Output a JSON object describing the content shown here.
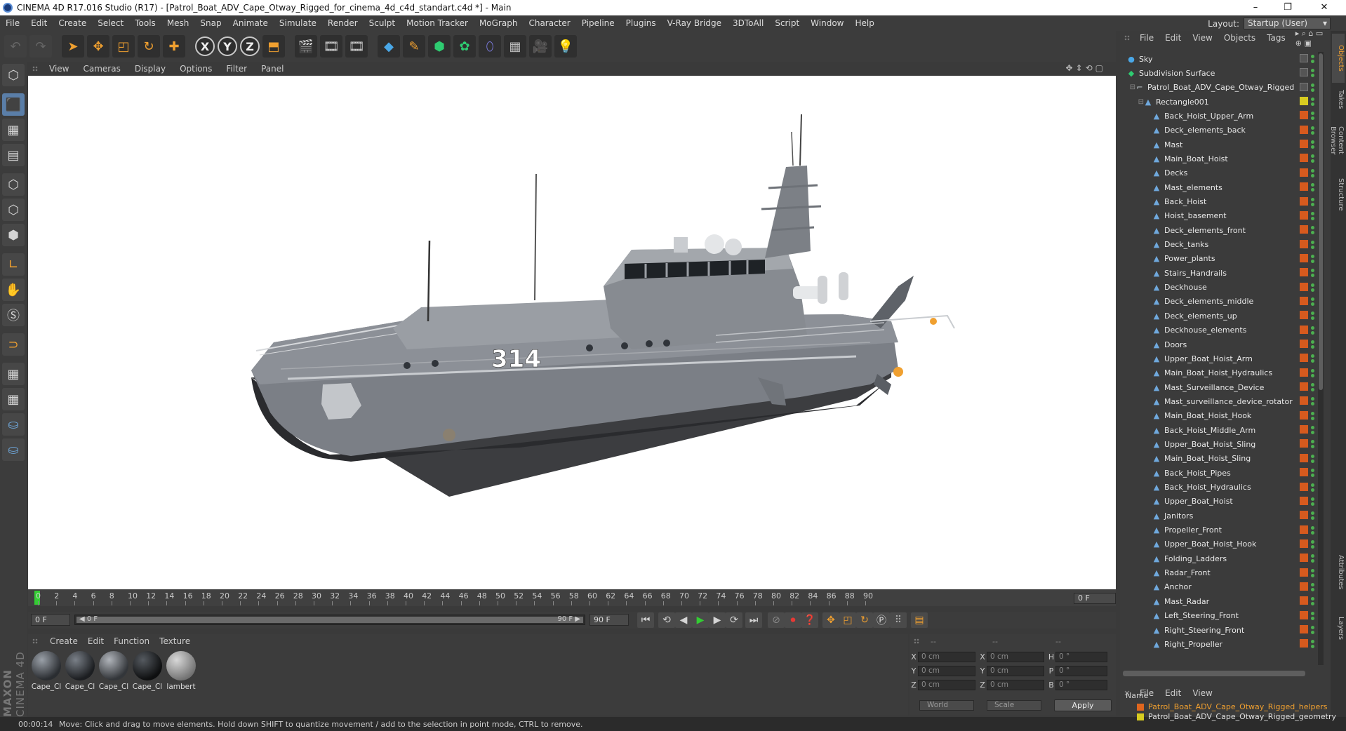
{
  "window": {
    "title": "CINEMA 4D R17.016 Studio (R17) - [Patrol_Boat_ADV_Cape_Otway_Rigged_for_cinema_4d_c4d_standart.c4d *] - Main",
    "minimize": "–",
    "maximize": "❐",
    "close": "✕"
  },
  "menubar": {
    "items": [
      "File",
      "Edit",
      "Create",
      "Select",
      "Tools",
      "Mesh",
      "Snap",
      "Animate",
      "Simulate",
      "Render",
      "Sculpt",
      "Motion Tracker",
      "MoGraph",
      "Character",
      "Pipeline",
      "Plugins",
      "V-Ray Bridge",
      "3DToAll",
      "Script",
      "Window",
      "Help"
    ]
  },
  "layout": {
    "label": "Layout:",
    "value": "Startup (User)"
  },
  "toolbar": {
    "axis_x": "X",
    "axis_y": "Y",
    "axis_z": "Z"
  },
  "viewport": {
    "menu": [
      "View",
      "Cameras",
      "Display",
      "Options",
      "Filter",
      "Panel"
    ],
    "hull_number": "314"
  },
  "timeline": {
    "ticks": [
      "0",
      "2",
      "4",
      "6",
      "8",
      "10",
      "12",
      "14",
      "16",
      "18",
      "20",
      "22",
      "24",
      "26",
      "28",
      "30",
      "32",
      "34",
      "36",
      "38",
      "40",
      "42",
      "44",
      "46",
      "48",
      "50",
      "52",
      "54",
      "56",
      "58",
      "60",
      "62",
      "64",
      "66",
      "68",
      "70",
      "72",
      "74",
      "76",
      "78",
      "80",
      "82",
      "84",
      "86",
      "88",
      "90"
    ],
    "end_frame": "0 F"
  },
  "transport": {
    "current_frame": "0 F",
    "slider_start": "◀ 0 F",
    "slider_end": "90 F ▶",
    "end_frame": "90 F"
  },
  "materials": {
    "menu": [
      "Create",
      "Edit",
      "Function",
      "Texture"
    ],
    "items": [
      "Cape_Cl",
      "Cape_Cl",
      "Cape_Cl",
      "Cape_Cl",
      "lambert"
    ]
  },
  "attributes": {
    "header": [
      "--",
      "--",
      "--"
    ],
    "rows": [
      {
        "a": "X",
        "av": "0 cm",
        "b": "X",
        "bv": "0 cm",
        "c": "H",
        "cv": "0 °"
      },
      {
        "a": "Y",
        "av": "0 cm",
        "b": "Y",
        "bv": "0 cm",
        "c": "P",
        "cv": "0 °"
      },
      {
        "a": "Z",
        "av": "0 cm",
        "b": "Z",
        "bv": "0 cm",
        "c": "B",
        "cv": "0 °"
      }
    ],
    "coord_mode": "World",
    "size_mode": "Scale",
    "apply": "Apply"
  },
  "status": {
    "time": "00:00:14",
    "message": "Move: Click and drag to move elements. Hold down SHIFT to quantize movement / add to the selection in point mode, CTRL to remove."
  },
  "objects": {
    "menu": [
      "File",
      "Edit",
      "View",
      "Objects",
      "Tags"
    ],
    "items": [
      {
        "name": "Sky",
        "depth": 0,
        "icon": "sky"
      },
      {
        "name": "Subdivision Surface",
        "depth": 0,
        "icon": "subd"
      },
      {
        "name": "Patrol_Boat_ADV_Cape_Otway_Rigged",
        "depth": 1,
        "icon": "null"
      },
      {
        "name": "Rectangle001",
        "depth": 2,
        "icon": "spline",
        "tag": "#d8cc20"
      },
      {
        "name": "Back_Hoist_Upper_Arm",
        "depth": 3
      },
      {
        "name": "Deck_elements_back",
        "depth": 3
      },
      {
        "name": "Mast",
        "depth": 3
      },
      {
        "name": "Main_Boat_Hoist",
        "depth": 3
      },
      {
        "name": "Decks",
        "depth": 3
      },
      {
        "name": "Mast_elements",
        "depth": 3
      },
      {
        "name": "Back_Hoist",
        "depth": 3
      },
      {
        "name": "Hoist_basement",
        "depth": 3
      },
      {
        "name": "Deck_elements_front",
        "depth": 3
      },
      {
        "name": "Deck_tanks",
        "depth": 3
      },
      {
        "name": "Power_plants",
        "depth": 3
      },
      {
        "name": "Stairs_Handrails",
        "depth": 3
      },
      {
        "name": "Deckhouse",
        "depth": 3
      },
      {
        "name": "Deck_elements_middle",
        "depth": 3
      },
      {
        "name": "Deck_elements_up",
        "depth": 3
      },
      {
        "name": "Deckhouse_elements",
        "depth": 3
      },
      {
        "name": "Doors",
        "depth": 3
      },
      {
        "name": "Upper_Boat_Hoist_Arm",
        "depth": 3
      },
      {
        "name": "Main_Boat_Hoist_Hydraulics",
        "depth": 3
      },
      {
        "name": "Mast_Surveillance_Device",
        "depth": 3
      },
      {
        "name": "Mast_surveillance_device_rotator",
        "depth": 3
      },
      {
        "name": "Main_Boat_Hoist_Hook",
        "depth": 3
      },
      {
        "name": "Back_Hoist_Middle_Arm",
        "depth": 3
      },
      {
        "name": "Upper_Boat_Hoist_Sling",
        "depth": 3
      },
      {
        "name": "Main_Boat_Hoist_Sling",
        "depth": 3
      },
      {
        "name": "Back_Hoist_Pipes",
        "depth": 3
      },
      {
        "name": "Back_Hoist_Hydraulics",
        "depth": 3
      },
      {
        "name": "Upper_Boat_Hoist",
        "depth": 3
      },
      {
        "name": "Janitors",
        "depth": 3
      },
      {
        "name": "Propeller_Front",
        "depth": 3
      },
      {
        "name": "Upper_Boat_Hoist_Hook",
        "depth": 3
      },
      {
        "name": "Folding_Ladders",
        "depth": 3
      },
      {
        "name": "Radar_Front",
        "depth": 3
      },
      {
        "name": "Anchor",
        "depth": 3
      },
      {
        "name": "Mast_Radar",
        "depth": 3
      },
      {
        "name": "Left_Steering_Front",
        "depth": 3
      },
      {
        "name": "Right_Steering_Front",
        "depth": 3
      },
      {
        "name": "Right_Propeller",
        "depth": 3
      }
    ]
  },
  "layers": {
    "menu": [
      "File",
      "Edit",
      "View"
    ],
    "header": "Name",
    "items": [
      {
        "name": "Patrol_Boat_ADV_Cape_Otway_Rigged_helpers",
        "color": "#e0661e",
        "text": "#f0a030"
      },
      {
        "name": "Patrol_Boat_ADV_Cape_Otway_Rigged_geometry",
        "color": "#d8cc20",
        "text": "#e0e0e0"
      }
    ]
  },
  "sidetabs": [
    "Objects",
    "Takes",
    "Content Browser",
    "Structure",
    "Attributes",
    "Layers"
  ],
  "colors": {
    "accent": "#f0a030",
    "tag_orange": "#d65a1e",
    "play_green": "#33cc33",
    "record_red": "#e53935"
  }
}
